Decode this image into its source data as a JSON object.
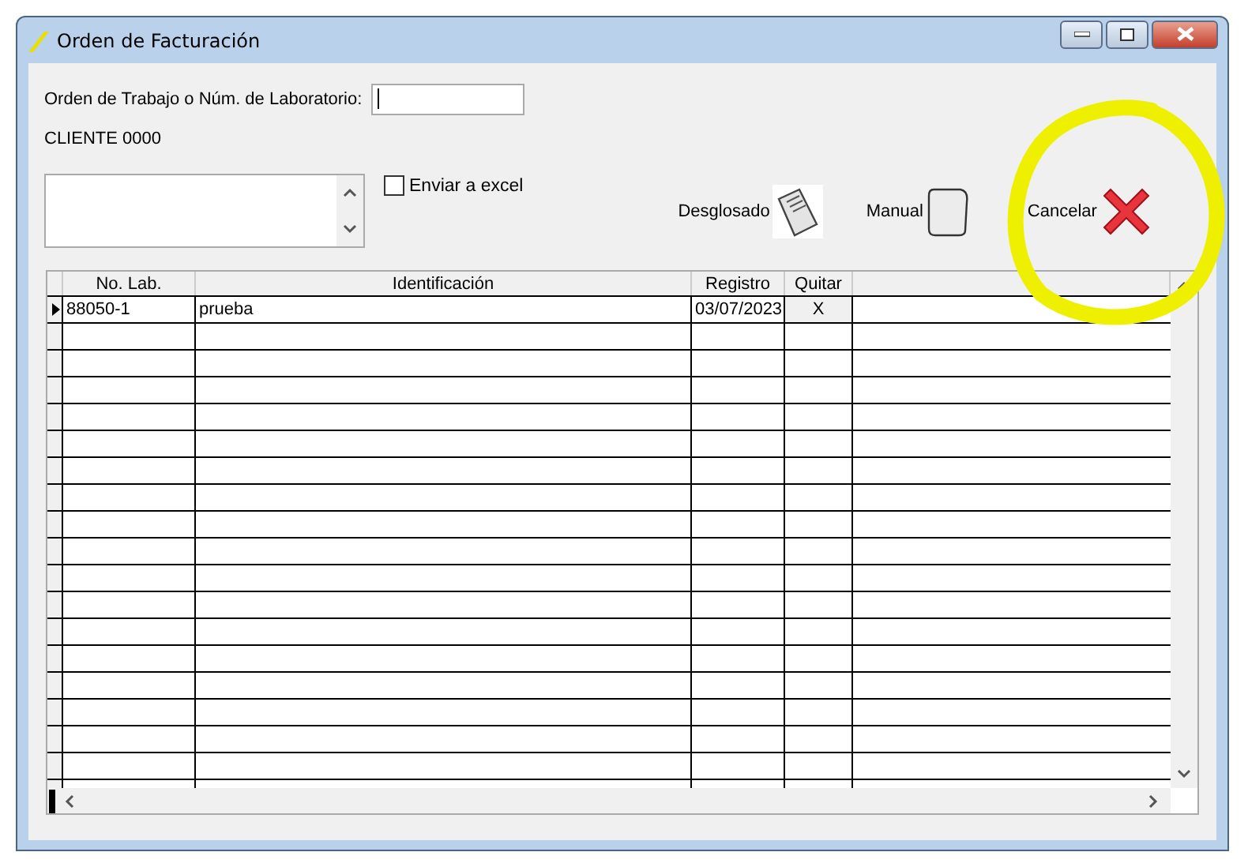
{
  "window": {
    "title": "Orden de Facturación"
  },
  "form": {
    "order_label": "Orden de Trabajo o Núm. de Laboratorio:",
    "client": "CLIENTE 0000"
  },
  "export_checkbox": {
    "label": "Enviar a excel",
    "checked": false
  },
  "actions": [
    {
      "label": "Desglosado",
      "kind": "document"
    },
    {
      "label": "Manual",
      "kind": "blank"
    },
    {
      "label": "Cancelar",
      "kind": "cancel"
    }
  ],
  "table": {
    "columns": [
      "No. Lab.",
      "Identificación",
      "Registro",
      "Quitar"
    ],
    "rows": [
      {
        "selected": true,
        "cells": [
          "88050-1",
          "prueba",
          "03/07/2023",
          "X"
        ]
      }
    ]
  }
}
